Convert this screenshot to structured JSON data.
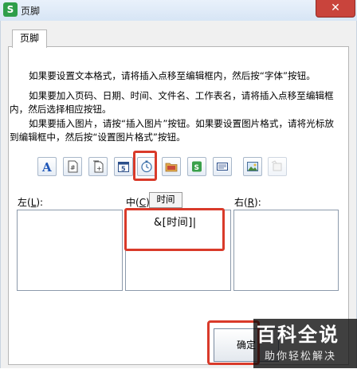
{
  "window": {
    "title": "页脚",
    "app_icon_letter": "S",
    "close_symbol": "✕"
  },
  "tab": {
    "label": "页脚"
  },
  "instructions": [
    "如果要设置文本格式，请将插入点移至编辑框内，然后按“字体”按钮。",
    "如果要加入页码、日期、时间、文件名、工作表名，请将插入点移至编辑框内，然后选择相应按钮。",
    "如果要插入图片，请按“插入图片”按钮。如果要设置图片格式，请将光标放到编辑框中，然后按“设置图片格式”按钮。"
  ],
  "toolbar": {
    "buttons": [
      {
        "name": "font-button",
        "icon": "font-A-icon"
      },
      {
        "name": "page-number-button",
        "icon": "page-number-icon"
      },
      {
        "name": "total-pages-button",
        "icon": "total-pages-icon"
      },
      {
        "name": "date-button",
        "icon": "calendar-5-icon"
      },
      {
        "name": "time-button",
        "icon": "clock-icon"
      },
      {
        "name": "file-path-button",
        "icon": "folder-icon"
      },
      {
        "name": "file-name-button",
        "icon": "excel-file-icon"
      },
      {
        "name": "sheet-name-button",
        "icon": "sheet-tab-icon"
      },
      {
        "name": "insert-picture-button",
        "icon": "picture-icon"
      },
      {
        "name": "format-picture-button",
        "icon": "format-picture-icon",
        "disabled": true
      }
    ],
    "tooltip": "时间"
  },
  "sections": {
    "left": {
      "label_prefix": "左(",
      "hotkey": "L",
      "label_suffix": "):",
      "content": ""
    },
    "center": {
      "label_prefix": "中(",
      "hotkey": "C",
      "label_suffix": ")",
      "content": "&[时间]|"
    },
    "right": {
      "label_prefix": "右(",
      "hotkey": "R",
      "label_suffix": "):",
      "content": ""
    }
  },
  "ok_button": {
    "label": "确定"
  },
  "watermark": {
    "title": "百科全说",
    "subtitle": "助你轻松解决"
  },
  "colors": {
    "highlight": "#d93a2a",
    "app_icon": "#2e9e4a",
    "close": "#c9443c"
  }
}
